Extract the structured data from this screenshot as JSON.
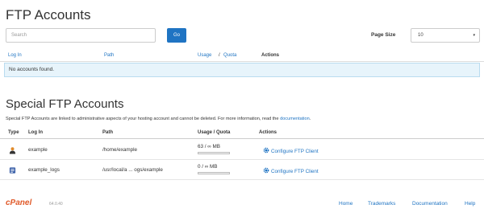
{
  "page": {
    "title": "FTP Accounts",
    "special_title": "Special FTP Accounts"
  },
  "search": {
    "placeholder": "Search",
    "go_label": "Go"
  },
  "page_size": {
    "label": "Page Size",
    "value": "10"
  },
  "ftp_table": {
    "columns": [
      "Log In",
      "Path",
      "Usage",
      "/",
      "Quota",
      "Actions"
    ],
    "empty_message": "No accounts found."
  },
  "special": {
    "description": "Special FTP Accounts are linked to administrative aspects of your hosting account and cannot be deleted. For more information, read the",
    "doc_link": "documentation",
    "doc_suffix": ".",
    "columns": [
      "Type",
      "Log In",
      "Path",
      "Usage / Quota",
      "Actions"
    ],
    "rows": [
      {
        "icon": "user-icon",
        "login": "example",
        "path": "/home/example",
        "usage": "63 / ∞ MB",
        "action": "Configure FTP Client"
      },
      {
        "icon": "log-icon",
        "login": "example_logs",
        "path": "/usr/local/a ... ogs/example",
        "usage": "0 / ∞ MB",
        "action": "Configure FTP Client"
      }
    ]
  },
  "footer": {
    "logo": "cPanel",
    "version": "64.0.40",
    "links": [
      "Home",
      "Trademarks",
      "Documentation",
      "Help"
    ]
  },
  "colors": {
    "accent": "#1f74c3",
    "info_bg": "#e7f4fb",
    "brand": "#e05a2a"
  }
}
